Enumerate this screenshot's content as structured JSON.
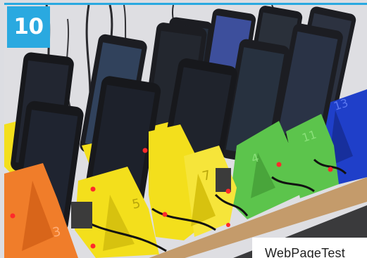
{
  "badge": {
    "number": "10"
  },
  "caption": {
    "text": "WebPageTest"
  },
  "stand_labels": [
    "3",
    "5",
    "7",
    "4",
    "11",
    "13"
  ],
  "colors": {
    "accent": "#2aa9e0",
    "orange_stand": "#f07d2a",
    "yellow_stand": "#f3df1c",
    "green_stand": "#5cc44c",
    "blue_stand": "#1f3fc9",
    "wood_shelf": "#c49b6b"
  }
}
